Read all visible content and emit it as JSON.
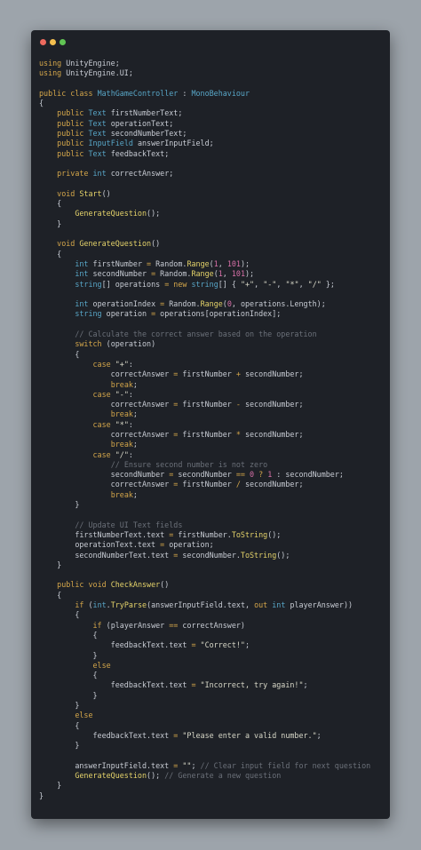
{
  "window": {
    "buttons": [
      {
        "name": "close-button",
        "color": "#ed6a5e"
      },
      {
        "name": "minimize-button",
        "color": "#f4bf4f"
      },
      {
        "name": "maximize-button",
        "color": "#61c554"
      }
    ]
  },
  "colors": {
    "background": "#9da4ab",
    "editor": "#1e2127",
    "keyword": "#d4a64a",
    "type": "#58a6c7",
    "function": "#e5d36a",
    "number": "#d770a8",
    "comment": "#6b7079"
  },
  "code_lines": [
    [
      [
        "kw",
        "using"
      ],
      [
        "df",
        " UnityEngine;"
      ]
    ],
    [
      [
        "kw",
        "using"
      ],
      [
        "df",
        " UnityEngine.UI;"
      ]
    ],
    [],
    [
      [
        "kw",
        "public class"
      ],
      [
        "df",
        " "
      ],
      [
        "ty",
        "MathGameController"
      ],
      [
        "df",
        " : "
      ],
      [
        "ty",
        "MonoBehaviour"
      ]
    ],
    [
      [
        "df",
        "{"
      ]
    ],
    [
      [
        "df",
        "    "
      ],
      [
        "kw",
        "public"
      ],
      [
        "df",
        " "
      ],
      [
        "ty",
        "Text"
      ],
      [
        "df",
        " firstNumberText;"
      ]
    ],
    [
      [
        "df",
        "    "
      ],
      [
        "kw",
        "public"
      ],
      [
        "df",
        " "
      ],
      [
        "ty",
        "Text"
      ],
      [
        "df",
        " operationText;"
      ]
    ],
    [
      [
        "df",
        "    "
      ],
      [
        "kw",
        "public"
      ],
      [
        "df",
        " "
      ],
      [
        "ty",
        "Text"
      ],
      [
        "df",
        " secondNumberText;"
      ]
    ],
    [
      [
        "df",
        "    "
      ],
      [
        "kw",
        "public"
      ],
      [
        "df",
        " "
      ],
      [
        "ty",
        "InputField"
      ],
      [
        "df",
        " answerInputField;"
      ]
    ],
    [
      [
        "df",
        "    "
      ],
      [
        "kw",
        "public"
      ],
      [
        "df",
        " "
      ],
      [
        "ty",
        "Text"
      ],
      [
        "df",
        " feedbackText;"
      ]
    ],
    [],
    [
      [
        "df",
        "    "
      ],
      [
        "kw",
        "private"
      ],
      [
        "df",
        " "
      ],
      [
        "ty",
        "int"
      ],
      [
        "df",
        " correctAnswer;"
      ]
    ],
    [],
    [
      [
        "df",
        "    "
      ],
      [
        "kw",
        "void"
      ],
      [
        "df",
        " "
      ],
      [
        "fn",
        "Start"
      ],
      [
        "df",
        "()"
      ]
    ],
    [
      [
        "df",
        "    {"
      ]
    ],
    [
      [
        "df",
        "        "
      ],
      [
        "fn",
        "GenerateQuestion"
      ],
      [
        "df",
        "();"
      ]
    ],
    [
      [
        "df",
        "    }"
      ]
    ],
    [],
    [
      [
        "df",
        "    "
      ],
      [
        "kw",
        "void"
      ],
      [
        "df",
        " "
      ],
      [
        "fn",
        "GenerateQuestion"
      ],
      [
        "df",
        "()"
      ]
    ],
    [
      [
        "df",
        "    {"
      ]
    ],
    [
      [
        "df",
        "        "
      ],
      [
        "ty",
        "int"
      ],
      [
        "df",
        " firstNumber "
      ],
      [
        "op",
        "="
      ],
      [
        "df",
        " Random."
      ],
      [
        "fn",
        "Range"
      ],
      [
        "df",
        "("
      ],
      [
        "num",
        "1"
      ],
      [
        "df",
        ", "
      ],
      [
        "num",
        "101"
      ],
      [
        "df",
        ");"
      ]
    ],
    [
      [
        "df",
        "        "
      ],
      [
        "ty",
        "int"
      ],
      [
        "df",
        " secondNumber "
      ],
      [
        "op",
        "="
      ],
      [
        "df",
        " Random."
      ],
      [
        "fn",
        "Range"
      ],
      [
        "df",
        "("
      ],
      [
        "num",
        "1"
      ],
      [
        "df",
        ", "
      ],
      [
        "num",
        "101"
      ],
      [
        "df",
        ");"
      ]
    ],
    [
      [
        "df",
        "        "
      ],
      [
        "ty",
        "string"
      ],
      [
        "df",
        "[] operations "
      ],
      [
        "op",
        "="
      ],
      [
        "df",
        " "
      ],
      [
        "kw",
        "new"
      ],
      [
        "df",
        " "
      ],
      [
        "ty",
        "string"
      ],
      [
        "df",
        "[] { "
      ],
      [
        "str",
        "\"+\""
      ],
      [
        "df",
        ", "
      ],
      [
        "str",
        "\"-\""
      ],
      [
        "df",
        ", "
      ],
      [
        "str",
        "\"*\""
      ],
      [
        "df",
        ", "
      ],
      [
        "str",
        "\"/\""
      ],
      [
        "df",
        " };"
      ]
    ],
    [],
    [
      [
        "df",
        "        "
      ],
      [
        "ty",
        "int"
      ],
      [
        "df",
        " operationIndex "
      ],
      [
        "op",
        "="
      ],
      [
        "df",
        " Random."
      ],
      [
        "fn",
        "Range"
      ],
      [
        "df",
        "("
      ],
      [
        "num",
        "0"
      ],
      [
        "df",
        ", operations.Length);"
      ]
    ],
    [
      [
        "df",
        "        "
      ],
      [
        "ty",
        "string"
      ],
      [
        "df",
        " operation "
      ],
      [
        "op",
        "="
      ],
      [
        "df",
        " operations[operationIndex];"
      ]
    ],
    [],
    [
      [
        "df",
        "        "
      ],
      [
        "com",
        "// Calculate the correct answer based on the operation"
      ]
    ],
    [
      [
        "df",
        "        "
      ],
      [
        "kw",
        "switch"
      ],
      [
        "df",
        " (operation)"
      ]
    ],
    [
      [
        "df",
        "        {"
      ]
    ],
    [
      [
        "df",
        "            "
      ],
      [
        "kw",
        "case"
      ],
      [
        "df",
        " "
      ],
      [
        "str",
        "\"+\""
      ],
      [
        "df",
        ":"
      ]
    ],
    [
      [
        "df",
        "                correctAnswer "
      ],
      [
        "op",
        "="
      ],
      [
        "df",
        " firstNumber "
      ],
      [
        "op",
        "+"
      ],
      [
        "df",
        " secondNumber;"
      ]
    ],
    [
      [
        "df",
        "                "
      ],
      [
        "kw",
        "break"
      ],
      [
        "df",
        ";"
      ]
    ],
    [
      [
        "df",
        "            "
      ],
      [
        "kw",
        "case"
      ],
      [
        "df",
        " "
      ],
      [
        "str",
        "\"-\""
      ],
      [
        "df",
        ":"
      ]
    ],
    [
      [
        "df",
        "                correctAnswer "
      ],
      [
        "op",
        "="
      ],
      [
        "df",
        " firstNumber "
      ],
      [
        "op",
        "-"
      ],
      [
        "df",
        " secondNumber;"
      ]
    ],
    [
      [
        "df",
        "                "
      ],
      [
        "kw",
        "break"
      ],
      [
        "df",
        ";"
      ]
    ],
    [
      [
        "df",
        "            "
      ],
      [
        "kw",
        "case"
      ],
      [
        "df",
        " "
      ],
      [
        "str",
        "\"*\""
      ],
      [
        "df",
        ":"
      ]
    ],
    [
      [
        "df",
        "                correctAnswer "
      ],
      [
        "op",
        "="
      ],
      [
        "df",
        " firstNumber "
      ],
      [
        "op",
        "*"
      ],
      [
        "df",
        " secondNumber;"
      ]
    ],
    [
      [
        "df",
        "                "
      ],
      [
        "kw",
        "break"
      ],
      [
        "df",
        ";"
      ]
    ],
    [
      [
        "df",
        "            "
      ],
      [
        "kw",
        "case"
      ],
      [
        "df",
        " "
      ],
      [
        "str",
        "\"/\""
      ],
      [
        "df",
        ":"
      ]
    ],
    [
      [
        "df",
        "                "
      ],
      [
        "com",
        "// Ensure second number is not zero"
      ]
    ],
    [
      [
        "df",
        "                secondNumber "
      ],
      [
        "op",
        "="
      ],
      [
        "df",
        " secondNumber "
      ],
      [
        "op",
        "=="
      ],
      [
        "df",
        " "
      ],
      [
        "num",
        "0"
      ],
      [
        "df",
        " "
      ],
      [
        "op",
        "?"
      ],
      [
        "df",
        " "
      ],
      [
        "num",
        "1"
      ],
      [
        "df",
        " : secondNumber;"
      ]
    ],
    [
      [
        "df",
        "                correctAnswer "
      ],
      [
        "op",
        "="
      ],
      [
        "df",
        " firstNumber "
      ],
      [
        "op",
        "/"
      ],
      [
        "df",
        " secondNumber;"
      ]
    ],
    [
      [
        "df",
        "                "
      ],
      [
        "kw",
        "break"
      ],
      [
        "df",
        ";"
      ]
    ],
    [
      [
        "df",
        "        }"
      ]
    ],
    [],
    [
      [
        "df",
        "        "
      ],
      [
        "com",
        "// Update UI Text fields"
      ]
    ],
    [
      [
        "df",
        "        firstNumberText.text "
      ],
      [
        "op",
        "="
      ],
      [
        "df",
        " firstNumber."
      ],
      [
        "fn",
        "ToString"
      ],
      [
        "df",
        "();"
      ]
    ],
    [
      [
        "df",
        "        operationText.text "
      ],
      [
        "op",
        "="
      ],
      [
        "df",
        " operation;"
      ]
    ],
    [
      [
        "df",
        "        secondNumberText.text "
      ],
      [
        "op",
        "="
      ],
      [
        "df",
        " secondNumber."
      ],
      [
        "fn",
        "ToString"
      ],
      [
        "df",
        "();"
      ]
    ],
    [
      [
        "df",
        "    }"
      ]
    ],
    [],
    [
      [
        "df",
        "    "
      ],
      [
        "kw",
        "public"
      ],
      [
        "df",
        " "
      ],
      [
        "kw",
        "void"
      ],
      [
        "df",
        " "
      ],
      [
        "fn",
        "CheckAnswer"
      ],
      [
        "df",
        "()"
      ]
    ],
    [
      [
        "df",
        "    {"
      ]
    ],
    [
      [
        "df",
        "        "
      ],
      [
        "kw",
        "if"
      ],
      [
        "df",
        " ("
      ],
      [
        "ty",
        "int"
      ],
      [
        "df",
        "."
      ],
      [
        "fn",
        "TryParse"
      ],
      [
        "df",
        "(answerInputField.text, "
      ],
      [
        "kw",
        "out"
      ],
      [
        "df",
        " "
      ],
      [
        "ty",
        "int"
      ],
      [
        "df",
        " playerAnswer))"
      ]
    ],
    [
      [
        "df",
        "        {"
      ]
    ],
    [
      [
        "df",
        "            "
      ],
      [
        "kw",
        "if"
      ],
      [
        "df",
        " (playerAnswer "
      ],
      [
        "op",
        "=="
      ],
      [
        "df",
        " correctAnswer)"
      ]
    ],
    [
      [
        "df",
        "            {"
      ]
    ],
    [
      [
        "df",
        "                feedbackText.text "
      ],
      [
        "op",
        "="
      ],
      [
        "df",
        " "
      ],
      [
        "str",
        "\"Correct!\""
      ],
      [
        "df",
        ";"
      ]
    ],
    [
      [
        "df",
        "            }"
      ]
    ],
    [
      [
        "df",
        "            "
      ],
      [
        "kw",
        "else"
      ]
    ],
    [
      [
        "df",
        "            {"
      ]
    ],
    [
      [
        "df",
        "                feedbackText.text "
      ],
      [
        "op",
        "="
      ],
      [
        "df",
        " "
      ],
      [
        "str",
        "\"Incorrect, try again!\""
      ],
      [
        "df",
        ";"
      ]
    ],
    [
      [
        "df",
        "            }"
      ]
    ],
    [
      [
        "df",
        "        }"
      ]
    ],
    [
      [
        "df",
        "        "
      ],
      [
        "kw",
        "else"
      ]
    ],
    [
      [
        "df",
        "        {"
      ]
    ],
    [
      [
        "df",
        "            feedbackText.text "
      ],
      [
        "op",
        "="
      ],
      [
        "df",
        " "
      ],
      [
        "str",
        "\"Please enter a valid number.\""
      ],
      [
        "df",
        ";"
      ]
    ],
    [
      [
        "df",
        "        }"
      ]
    ],
    [],
    [
      [
        "df",
        "        answerInputField.text "
      ],
      [
        "op",
        "="
      ],
      [
        "df",
        " "
      ],
      [
        "str",
        "\"\""
      ],
      [
        "df",
        "; "
      ],
      [
        "com",
        "// Clear input field for next question"
      ]
    ],
    [
      [
        "df",
        "        "
      ],
      [
        "fn",
        "GenerateQuestion"
      ],
      [
        "df",
        "(); "
      ],
      [
        "com",
        "// Generate a new question"
      ]
    ],
    [
      [
        "df",
        "    }"
      ]
    ],
    [
      [
        "df",
        "}"
      ]
    ]
  ]
}
